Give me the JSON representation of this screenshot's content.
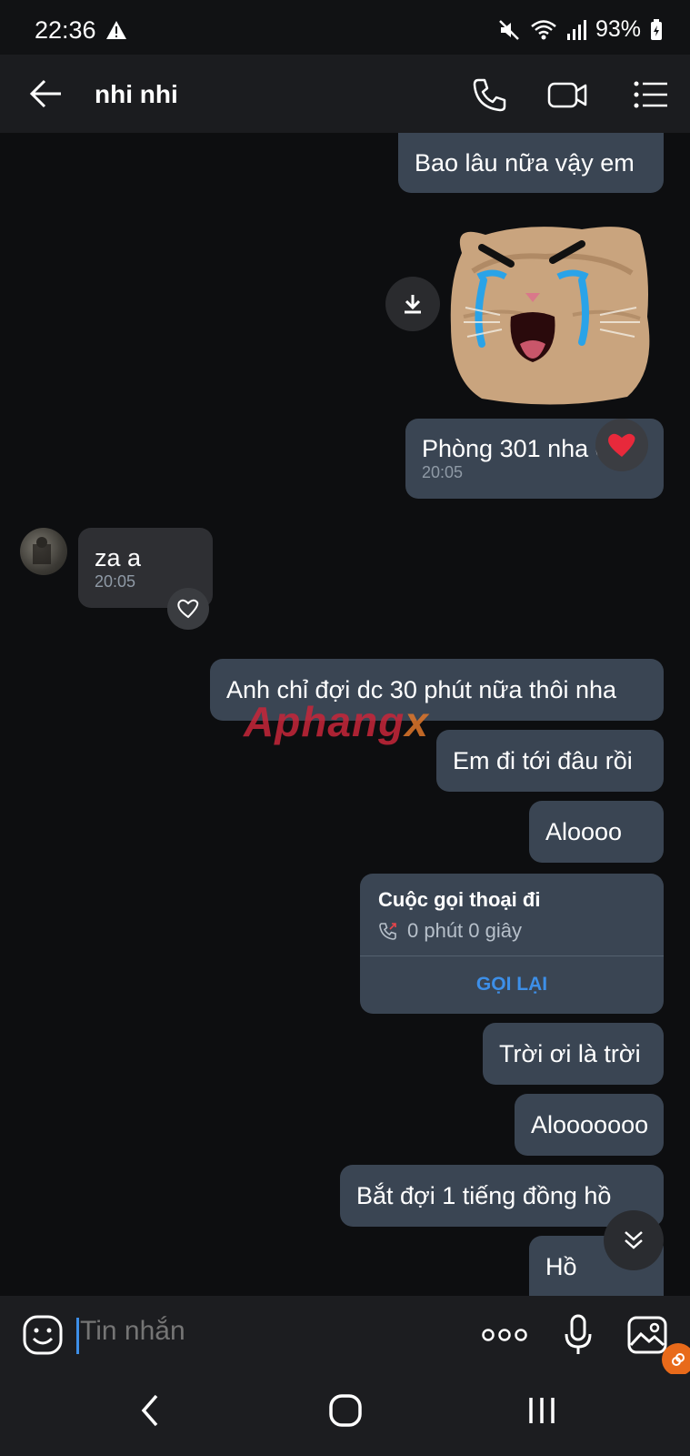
{
  "status": {
    "time": "22:36",
    "battery": "93%",
    "icons": [
      "warning-icon",
      "mute-icon",
      "wifi-icon",
      "signal-icon",
      "battery-icon"
    ]
  },
  "header": {
    "title": "nhi nhi",
    "icons": [
      "back-arrow-icon",
      "phone-icon",
      "video-icon",
      "menu-icon"
    ]
  },
  "messages": [
    {
      "dir": "out",
      "text": "Bao lâu nữa vậy em"
    },
    {
      "dir": "out",
      "type": "sticker",
      "description": "crying-cat-sticker"
    },
    {
      "dir": "out",
      "text": "Phòng 301 nha em",
      "time": "20:05",
      "reaction": "heart"
    },
    {
      "dir": "in",
      "text": "za a",
      "time": "20:05"
    },
    {
      "dir": "out",
      "text": "Anh chỉ đợi dc 30 phút nữa thôi nha"
    },
    {
      "dir": "out",
      "text": "Em đi tới đâu rồi"
    },
    {
      "dir": "out",
      "text": "Aloooo"
    },
    {
      "dir": "out",
      "text": "Trời ơi là trời"
    },
    {
      "dir": "out",
      "text": "Alooooooo"
    },
    {
      "dir": "out",
      "text": "Bắt đợi 1 tiếng đồng hồ"
    },
    {
      "dir": "out",
      "text": "Hồ"
    }
  ],
  "call_card": {
    "title": "Cuộc gọi thoại đi",
    "duration": "0 phút 0 giây",
    "callback_label": "GỌI LẠI"
  },
  "watermark": {
    "main": "Aphang",
    "suffix": "x"
  },
  "input": {
    "placeholder": "Tin nhắn"
  },
  "colors": {
    "outgoing_bubble": "#3a4553",
    "incoming_bubble": "#2e2f33",
    "accent": "#3d8fe8",
    "background": "#0d0e10"
  }
}
